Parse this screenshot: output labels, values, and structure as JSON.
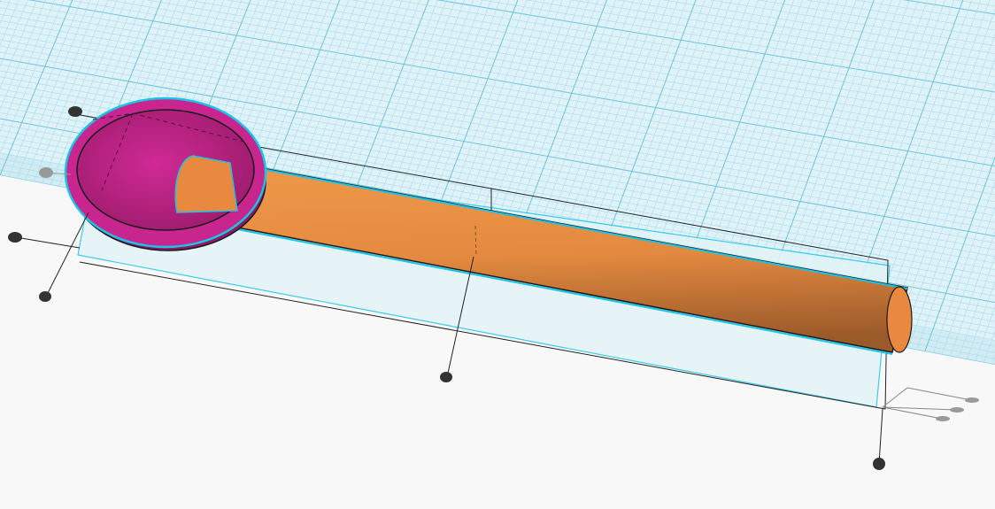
{
  "viewport": {
    "background_color": "#f8f8f8",
    "workplane_color": "#dff2f8",
    "grid_minor_color": "#a9dcec",
    "grid_major_color": "#6cc4de"
  },
  "objects": [
    {
      "name": "spoon-bowl",
      "color": "#c8258e",
      "selected": true
    },
    {
      "name": "spoon-handle",
      "color": "#e8893f",
      "selected": true
    }
  ],
  "selection": {
    "outline_color": "#18c4e8",
    "handle_color": "#333333"
  }
}
